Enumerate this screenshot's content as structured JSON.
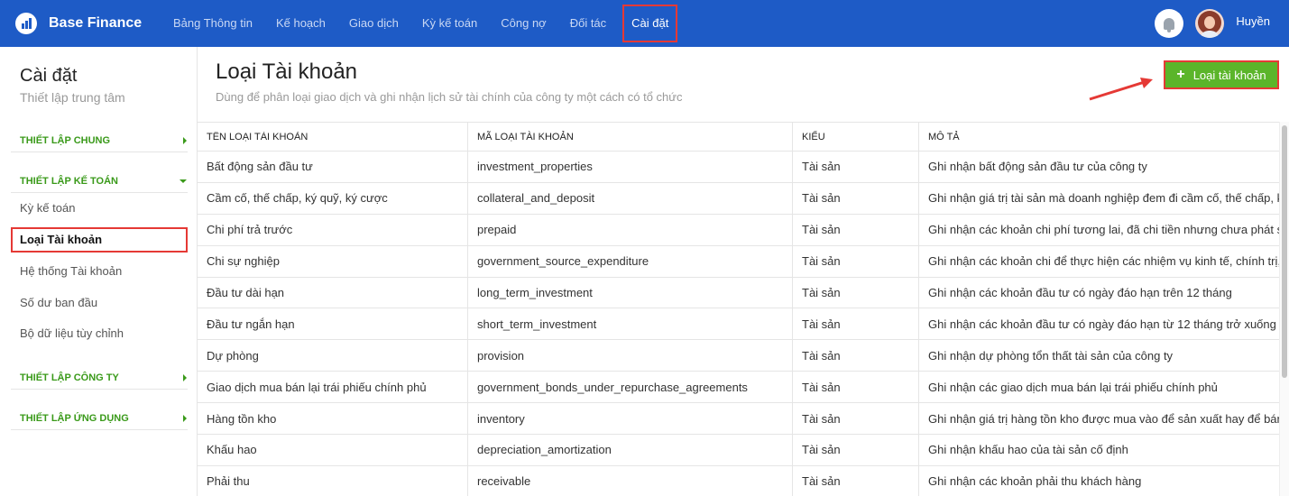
{
  "brand": {
    "name": "Base Finance"
  },
  "nav": [
    {
      "label": "Bảng Thông tin"
    },
    {
      "label": "Kế hoạch"
    },
    {
      "label": "Giao dịch"
    },
    {
      "label": "Kỳ kế toán"
    },
    {
      "label": "Công nợ"
    },
    {
      "label": "Đối tác"
    },
    {
      "label": "Cài đặt",
      "active": true
    }
  ],
  "user": {
    "name": "Huyền"
  },
  "sidebar": {
    "title": "Cài đặt",
    "subtitle": "Thiết lập trung tâm",
    "sections": {
      "general": "THIẾT LẬP CHUNG",
      "accounting": "THIẾT LẬP KẾ TOÁN",
      "company": "THIẾT LẬP CÔNG TY",
      "app": "THIẾT LẬP ỨNG DỤNG"
    },
    "items": [
      {
        "label": "Kỳ kế toán"
      },
      {
        "label": "Loại Tài khoản"
      },
      {
        "label": "Hệ thống Tài khoản"
      },
      {
        "label": "Số dư ban đầu"
      },
      {
        "label": "Bộ dữ liệu tùy chỉnh"
      }
    ]
  },
  "main": {
    "title": "Loại Tài khoản",
    "description": "Dùng để phân loại giao dịch và ghi nhận lịch sử tài chính của công ty một cách có tổ chức",
    "add_button": "Loại tài khoản"
  },
  "table": {
    "headers": [
      "TÊN LOẠI TÀI KHOẢN",
      "MÃ LOẠI TÀI KHOẢN",
      "KIỂU",
      "MÔ TẢ"
    ],
    "rows": [
      [
        "Bất động sản đầu tư",
        "investment_properties",
        "Tài sản",
        "Ghi nhận bất động sản đầu tư của công ty"
      ],
      [
        "Cầm cố, thế chấp, ký quỹ, ký cược",
        "collateral_and_deposit",
        "Tài sản",
        "Ghi nhận giá trị tài sản mà doanh nghiệp đem đi cầm cố, thế chấp, ký"
      ],
      [
        "Chi phí trả trước",
        "prepaid",
        "Tài sản",
        "Ghi nhận các khoản chi phí tương lai, đã chi tiền nhưng chưa phát si"
      ],
      [
        "Chi sự nghiệp",
        "government_source_expenditure",
        "Tài sản",
        "Ghi nhận các khoản chi để thực hiện các nhiệm vụ kinh tế, chính trị,"
      ],
      [
        "Đầu tư dài hạn",
        "long_term_investment",
        "Tài sản",
        "Ghi nhận các khoản đầu tư có ngày đáo hạn trên 12 tháng"
      ],
      [
        "Đầu tư ngắn hạn",
        "short_term_investment",
        "Tài sản",
        "Ghi nhận các khoản đầu tư có ngày đáo hạn từ 12 tháng trở xuống"
      ],
      [
        "Dự phòng",
        "provision",
        "Tài sản",
        "Ghi nhận dự phòng tổn thất tài sản của công ty"
      ],
      [
        "Giao dịch mua bán lại trái phiếu chính phủ",
        "government_bonds_under_repurchase_agreements",
        "Tài sản",
        "Ghi nhận các giao dịch mua bán lại trái phiếu chính phủ"
      ],
      [
        "Hàng tồn kho",
        "inventory",
        "Tài sản",
        "Ghi nhận giá trị hàng tồn kho được mua vào để sản xuất hay để bán"
      ],
      [
        "Khấu hao",
        "depreciation_amortization",
        "Tài sản",
        "Ghi nhận khấu hao của tài sản cố định"
      ],
      [
        "Phải thu",
        "receivable",
        "Tài sản",
        "Ghi nhận các khoản phải thu khách hàng"
      ]
    ]
  },
  "colors": {
    "topbar": "#1e5bc6",
    "accent_green": "#5bb52a",
    "annotation_red": "#e53935"
  }
}
